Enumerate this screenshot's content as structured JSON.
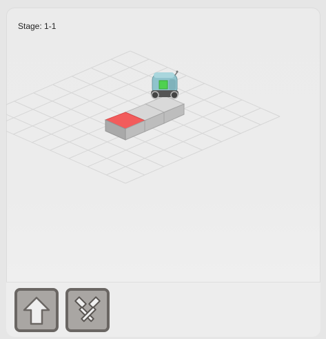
{
  "header": {
    "stage_label": "Stage: 1-1"
  },
  "board": {
    "grid_size": 8,
    "path_tiles": 3,
    "target_tile_color": "#f25c5c",
    "path_tile_color": "#cfcfcf",
    "robot": {
      "body_color": "#8fc3cc",
      "eye_color": "#4fd14f"
    }
  },
  "toolbar": {
    "buttons": [
      {
        "icon": "arrow-up-icon",
        "action": "forward"
      },
      {
        "icon": "hammer-icon",
        "action": "action"
      }
    ]
  }
}
